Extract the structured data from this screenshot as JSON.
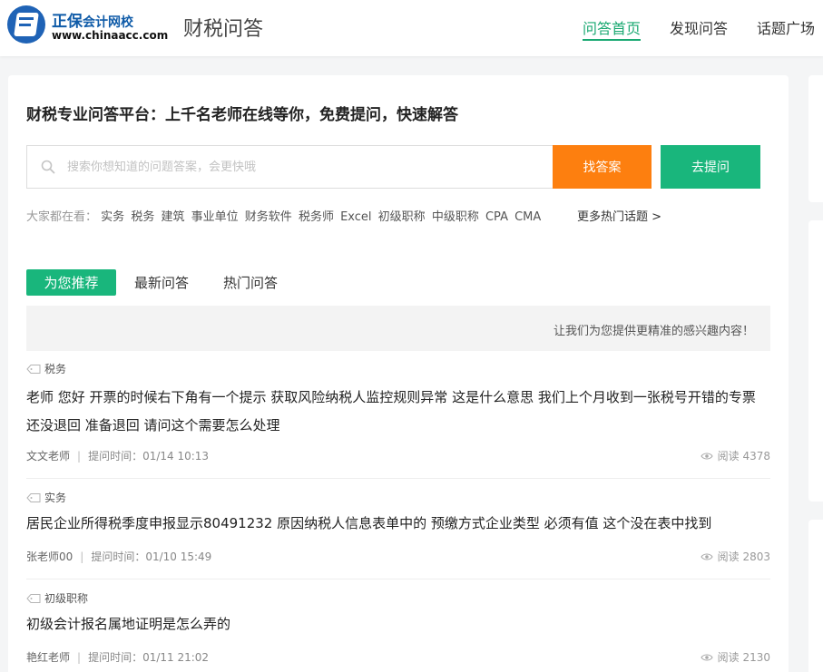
{
  "brand": {
    "name": "正保",
    "name2": "会计网校",
    "domain": "www.chinaacc.com",
    "site_title": "财税问答"
  },
  "nav": [
    {
      "label": "问答首页",
      "active": true
    },
    {
      "label": "发现问答",
      "active": false
    },
    {
      "label": "话题广场",
      "active": false
    }
  ],
  "slogan": "财税专业问答平台：上千名老师在线等你，免费提问，快速解答",
  "search": {
    "placeholder": "搜索你想知道的问题答案，会更快哦",
    "find_label": "找答案",
    "ask_label": "去提问"
  },
  "hot": {
    "label": "大家都在看：",
    "tags": [
      "实务",
      "税务",
      "建筑",
      "事业单位",
      "财务软件",
      "税务师",
      "Excel",
      "初级职称",
      "中级职称",
      "CPA",
      "CMA"
    ],
    "more": "更多热门话题 >"
  },
  "tabs": [
    {
      "label": "为您推荐",
      "active": true
    },
    {
      "label": "最新问答",
      "active": false
    },
    {
      "label": "热门问答",
      "active": false
    }
  ],
  "notice": "让我们为您提供更精准的感兴趣内容！",
  "questions": [
    {
      "tag": "税务",
      "title": "老师 您好 开票的时候右下角有一个提示 获取风险纳税人监控规则异常 这是什么意思 我们上个月收到一张税号开错的专票 还没退回 准备退回 请问这个需要怎么处理",
      "author": "文文老师",
      "time": "提问时间：01/14 10:13",
      "reads": "阅读 4378"
    },
    {
      "tag": "实务",
      "title": "居民企业所得税季度申报显示80491232 原因纳税人信息表单中的 预缴方式企业类型 必须有值 这个没在表中找到",
      "author": "张老师00",
      "time": "提问时间：01/10 15:49",
      "reads": "阅读 2803"
    },
    {
      "tag": "初级职称",
      "title": "初级会计报名属地证明是怎么弄的",
      "author": "艳红老师",
      "time": "提问时间：01/11 21:02",
      "reads": "阅读 2130"
    }
  ],
  "colors": {
    "accent_green": "#19b67c",
    "accent_orange": "#fd7f0f",
    "brand_blue": "#1f63b6"
  }
}
